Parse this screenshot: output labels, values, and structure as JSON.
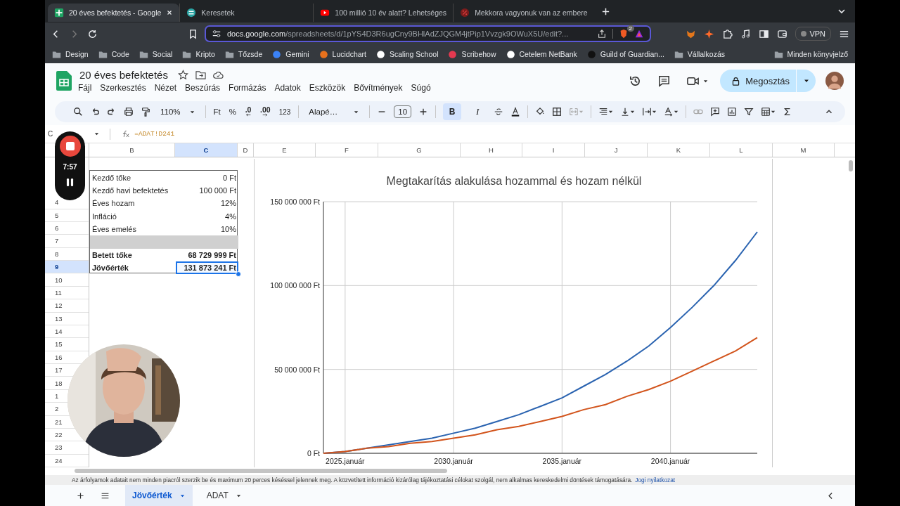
{
  "browser": {
    "tabs": [
      {
        "title": "20 éves befektetés - Google",
        "selected": true
      },
      {
        "title": "Keresetek",
        "selected": false
      },
      {
        "title": "100 millió 10 év alatt? Lehetséges",
        "selected": false
      },
      {
        "title": "Mekkora vagyonuk van az embere",
        "selected": false
      }
    ],
    "url_host": "docs.google.com",
    "url_path": "/spreadsheets/d/1pYS4D3R6ugCny9BHlAdZJQGM4jtPip1Vvzgk9OWuX5U/edit?...",
    "shield_badge": "2",
    "vpn": "VPN"
  },
  "bookmarks": [
    {
      "label": "Design",
      "kind": "folder"
    },
    {
      "label": "Code",
      "kind": "folder"
    },
    {
      "label": "Social",
      "kind": "folder"
    },
    {
      "label": "Kripto",
      "kind": "folder"
    },
    {
      "label": "Tőzsde",
      "kind": "folder"
    },
    {
      "label": "Gemini",
      "kind": "site"
    },
    {
      "label": "Lucidchart",
      "kind": "site"
    },
    {
      "label": "Scaling School",
      "kind": "site"
    },
    {
      "label": "Scribehow",
      "kind": "site"
    },
    {
      "label": "Cetelem NetBank",
      "kind": "site"
    },
    {
      "label": "Guild of Guardian...",
      "kind": "site"
    },
    {
      "label": "Vállalkozás",
      "kind": "folder"
    }
  ],
  "bookmarks_end": "Minden könyvjelző",
  "sheets": {
    "title": "20 éves befektetés",
    "menu": [
      "Fájl",
      "Szerkesztés",
      "Nézet",
      "Beszúrás",
      "Formázás",
      "Adatok",
      "Eszközök",
      "Bővítmények",
      "Súgó"
    ],
    "share": "Megosztás"
  },
  "toolbar": {
    "zoom": "110%",
    "currency": "Ft",
    "percent": "%",
    "dec_less": ".0",
    "dec_more": ".00",
    "number_format": "123",
    "font": "Alapé…",
    "font_size": "10",
    "bold": {
      "label": "B",
      "on": true
    },
    "italic": {
      "label": "I",
      "on": false
    }
  },
  "formula_bar": {
    "name_box": "C",
    "formula": "=ADAT!D241"
  },
  "columns": [
    {
      "label": "B",
      "selected": false
    },
    {
      "label": "C",
      "selected": true
    },
    {
      "label": "D",
      "selected": false
    },
    {
      "label": "E",
      "selected": false
    },
    {
      "label": "F",
      "selected": false
    },
    {
      "label": "G",
      "selected": false
    },
    {
      "label": "H",
      "selected": false
    },
    {
      "label": "I",
      "selected": false
    },
    {
      "label": "J",
      "selected": false
    },
    {
      "label": "K",
      "selected": false
    },
    {
      "label": "L",
      "selected": false
    },
    {
      "label": "M",
      "selected": false
    }
  ],
  "rows": [
    {
      "label": "4",
      "selected": false
    },
    {
      "label": "5",
      "selected": false
    },
    {
      "label": "6",
      "selected": false
    },
    {
      "label": "7",
      "selected": false
    },
    {
      "label": "8",
      "selected": false
    },
    {
      "label": "9",
      "selected": true
    },
    {
      "label": "10",
      "selected": false
    },
    {
      "label": "11",
      "selected": false
    },
    {
      "label": "12",
      "selected": false
    },
    {
      "label": "13",
      "selected": false
    },
    {
      "label": "14",
      "selected": false
    },
    {
      "label": "15",
      "selected": false
    },
    {
      "label": "16",
      "selected": false
    },
    {
      "label": "17",
      "selected": false
    },
    {
      "label": "18",
      "selected": false
    },
    {
      "label": "1",
      "selected": false
    },
    {
      "label": "2",
      "selected": false
    },
    {
      "label": "21",
      "selected": false
    },
    {
      "label": "22",
      "selected": false
    },
    {
      "label": "23",
      "selected": false
    },
    {
      "label": "24",
      "selected": false
    }
  ],
  "table": [
    {
      "kind": "normal",
      "label": "Kezdő tőke",
      "value": "0 Ft",
      "selected": false
    },
    {
      "kind": "normal",
      "label": "Kezdő havi befektetés",
      "value": "100 000 Ft",
      "selected": false
    },
    {
      "kind": "normal",
      "label": "Éves hozam",
      "value": "12%",
      "selected": false
    },
    {
      "kind": "normal",
      "label": "Infláció",
      "value": "4%",
      "selected": false
    },
    {
      "kind": "normal",
      "label": "Éves emelés",
      "value": "10%",
      "selected": false
    },
    {
      "kind": "spacer"
    },
    {
      "kind": "bold",
      "label": "Betett tőke",
      "value": "68 729 999 Ft",
      "selected": false
    },
    {
      "kind": "bold",
      "label": "Jövőérték",
      "value": "131 873 241 Ft",
      "selected": true
    }
  ],
  "chart": {
    "chart_data": {
      "type": "line",
      "title": "Megtakarítás alakulása hozammal és hozam nélkül",
      "categories": [
        null,
        "2025.január",
        null,
        null,
        null,
        null,
        "2030.január",
        null,
        null,
        null,
        null,
        "2035.január",
        null,
        null,
        null,
        null,
        "2040.január",
        null,
        null,
        null,
        null
      ],
      "series": [
        {
          "color": "#2a63b0",
          "values": [
            0,
            1000000,
            3000000,
            5000000,
            7000000,
            9000000,
            12000000,
            15000000,
            19000000,
            23000000,
            28000000,
            33000000,
            40000000,
            47000000,
            55000000,
            64000000,
            75000000,
            87000000,
            100000000,
            115000000,
            132000000
          ]
        },
        {
          "color": "#d2541c",
          "values": [
            0,
            1000000,
            3000000,
            4000000,
            6000000,
            7000000,
            9000000,
            11000000,
            14000000,
            16000000,
            19000000,
            22000000,
            26000000,
            29000000,
            34000000,
            38000000,
            43000000,
            49000000,
            55000000,
            61000000,
            69000000
          ]
        }
      ],
      "ylim": [
        0,
        150000000
      ],
      "grid": true,
      "yticks": [
        {
          "value": 0,
          "label": "0 Ft"
        },
        {
          "value": 50000000,
          "label": "50 000 000 Ft"
        },
        {
          "value": 100000000,
          "label": "100 000 000 Ft"
        },
        {
          "value": 150000000,
          "label": "150 000 000 Ft"
        }
      ]
    }
  },
  "recorder": {
    "time": "7:57"
  },
  "notice": {
    "text": "Az árfolyamok adatait nem minden piacról szerzik be és maximum 20 perces késéssel jelennek meg. A közvetített információ kizárólag tájékoztatási célokat szolgál, nem alkalmas kereskedelmi döntések támogatására.",
    "link": "Jogi nyilatkozat"
  },
  "sheet_tabs": [
    {
      "label": "Jövőérték",
      "selected": true
    },
    {
      "label": "ADAT",
      "selected": false
    }
  ]
}
